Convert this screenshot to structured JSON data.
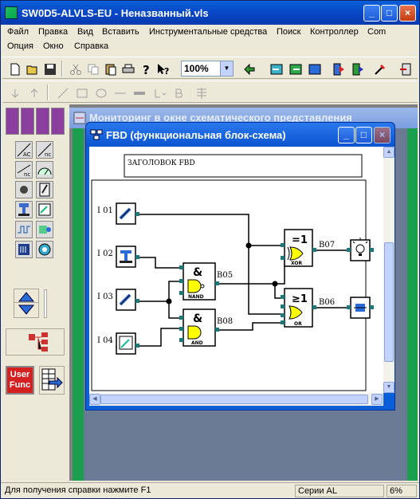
{
  "window": {
    "title": "SW0D5-ALVLS-EU - Неназванный.vls"
  },
  "menu": {
    "row1": [
      "Файл",
      "Правка",
      "Вид",
      "Вставить",
      "Инструментальные средства",
      "Поиск",
      "Контроллер",
      "Com"
    ],
    "row2": [
      "Опция",
      "Окно",
      "Справка"
    ]
  },
  "toolbar": {
    "zoom": "100%"
  },
  "palette": {
    "user_func_line1": "User",
    "user_func_line2": "Func"
  },
  "monitor_window": {
    "title": "Мониторинг в окне схематического представления"
  },
  "fbd_window": {
    "title": "FBD (функциональная блок-схема)"
  },
  "diagram": {
    "header": "ЗАГОЛОВОК FBD",
    "inputs": [
      "I 01",
      "I 02",
      "I 03",
      "I 04"
    ],
    "blocks": [
      {
        "symbol": "&",
        "type": "NAND",
        "output": "B05"
      },
      {
        "symbol": "&",
        "type": "AND",
        "output": "B08"
      },
      {
        "symbol": "=1",
        "type": "XOR",
        "output": "B07"
      },
      {
        "symbol": "≥1",
        "type": "OR",
        "output": "B06"
      }
    ]
  },
  "status": {
    "help": "Для получения справки нажмите F1",
    "series": "Серии AL",
    "percent": "6%"
  },
  "colors": {
    "title_blue": "#0a5fd8",
    "block_yellow": "#ffff00",
    "wire": "#000000"
  }
}
